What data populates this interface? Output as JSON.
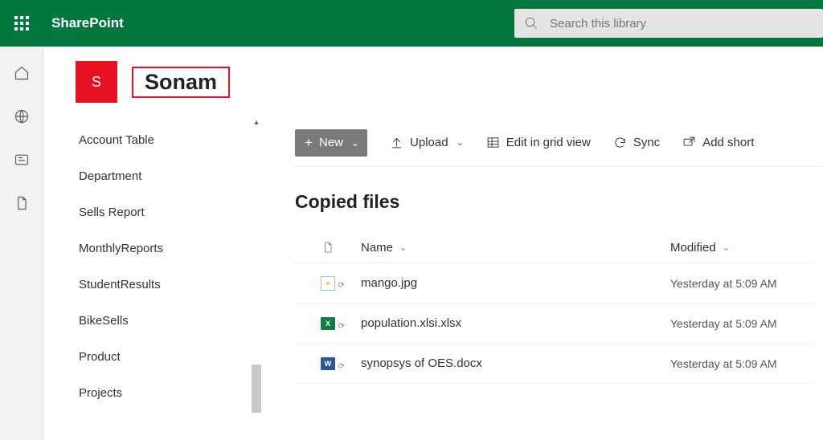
{
  "suite": {
    "brand": "SharePoint",
    "search_placeholder": "Search this library"
  },
  "site": {
    "avatar_initial": "S",
    "title": "Sonam"
  },
  "side_nav": {
    "items": [
      {
        "label": "Account Table"
      },
      {
        "label": "Department"
      },
      {
        "label": "Sells Report"
      },
      {
        "label": "MonthlyReports"
      },
      {
        "label": "StudentResults"
      },
      {
        "label": "BikeSells"
      },
      {
        "label": "Product"
      },
      {
        "label": "Projects"
      }
    ]
  },
  "command_bar": {
    "new_label": "New",
    "upload_label": "Upload",
    "edit_grid_label": "Edit in grid view",
    "sync_label": "Sync",
    "add_shortcut_label": "Add short"
  },
  "main": {
    "section_title": "Copied files",
    "columns": {
      "name": "Name",
      "modified": "Modified"
    },
    "files": [
      {
        "type": "image",
        "name": "mango.jpg",
        "modified": "Yesterday at 5:09 AM"
      },
      {
        "type": "excel",
        "name": "population.xlsi.xlsx",
        "modified": "Yesterday at 5:09 AM"
      },
      {
        "type": "word",
        "name": "synopsys of OES.docx",
        "modified": "Yesterday at 5:09 AM"
      }
    ]
  }
}
